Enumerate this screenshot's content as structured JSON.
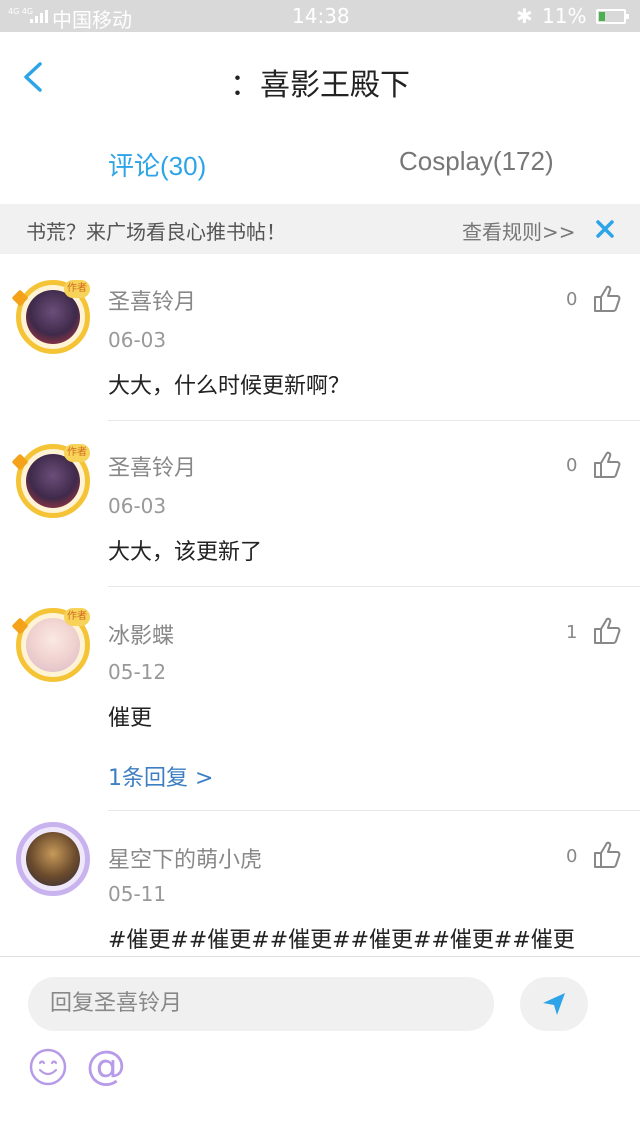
{
  "status_bar": {
    "carrier": "中国移动",
    "time": "14:38",
    "battery": "11%",
    "signal_label": "4G 4G",
    "battery_level": 0.11
  },
  "header": {
    "title": "：喜影王殿下"
  },
  "tabs": [
    {
      "label": "评论(30)",
      "active": true
    },
    {
      "label": "Cosplay(172)",
      "active": false
    }
  ],
  "banner": {
    "text": "书荒？来广场看良心推书帖！",
    "rules_link": "查看规则>>"
  },
  "comments": [
    {
      "username": "圣喜铃月",
      "date": "06-03",
      "content": "大大，什么时候更新啊？",
      "likes": "0",
      "author_tag": "作者"
    },
    {
      "username": "圣喜铃月",
      "date": "06-03",
      "content": "大大，该更新了",
      "likes": "0",
      "author_tag": "作者"
    },
    {
      "username": "冰影蝶",
      "date": "05-12",
      "content": "催更",
      "likes": "1",
      "author_tag": "作者",
      "replies": "1条回复 >"
    },
    {
      "username": "星空下的萌小虎",
      "date": "05-11",
      "content": "#催更##催更##催更##催更##催更##催更",
      "likes": "0"
    }
  ],
  "input_bar": {
    "placeholder": "回复圣喜铃月",
    "at_symbol": "@"
  },
  "colors": {
    "accent": "#2ea4e8",
    "reply_link": "#3d7fc2",
    "avatar_ring": "#f5c436",
    "emoji_purple": "#b79be8"
  }
}
